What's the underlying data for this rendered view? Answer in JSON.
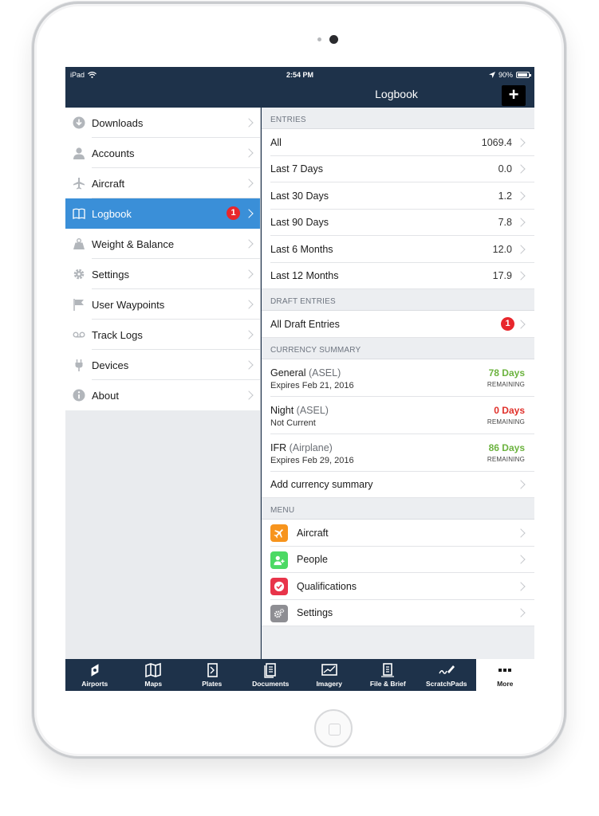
{
  "status_bar": {
    "carrier": "iPad",
    "time": "2:54 PM",
    "battery": "90%"
  },
  "nav": {
    "title": "Logbook",
    "add_label": "+"
  },
  "sidebar": {
    "items": [
      {
        "label": "Downloads",
        "icon": "download-icon"
      },
      {
        "label": "Accounts",
        "icon": "person-icon"
      },
      {
        "label": "Aircraft",
        "icon": "airplane-icon"
      },
      {
        "label": "Logbook",
        "icon": "book-icon",
        "badge": "1",
        "active": true
      },
      {
        "label": "Weight & Balance",
        "icon": "weight-icon"
      },
      {
        "label": "Settings",
        "icon": "gear-icon"
      },
      {
        "label": "User Waypoints",
        "icon": "flag-icon"
      },
      {
        "label": "Track Logs",
        "icon": "tracklog-icon"
      },
      {
        "label": "Devices",
        "icon": "plug-icon"
      },
      {
        "label": "About",
        "icon": "info-icon"
      }
    ]
  },
  "entries": {
    "header": "ENTRIES",
    "rows": [
      {
        "label": "All",
        "value": "1069.4"
      },
      {
        "label": "Last 7 Days",
        "value": "0.0"
      },
      {
        "label": "Last 30 Days",
        "value": "1.2"
      },
      {
        "label": "Last 90 Days",
        "value": "7.8"
      },
      {
        "label": "Last 6 Months",
        "value": "12.0"
      },
      {
        "label": "Last 12 Months",
        "value": "17.9"
      }
    ]
  },
  "draft": {
    "header": "DRAFT ENTRIES",
    "label": "All Draft Entries",
    "badge": "1"
  },
  "currency": {
    "header": "CURRENCY SUMMARY",
    "rows": [
      {
        "name": "General",
        "qual": "(ASEL)",
        "sub": "Expires Feb 21, 2016",
        "days": "78 Days",
        "remaining": "REMAINING",
        "color": "#6cb33f"
      },
      {
        "name": "Night",
        "qual": "(ASEL)",
        "sub": "Not Current",
        "days": "0 Days",
        "remaining": "REMAINING",
        "color": "#e0302a"
      },
      {
        "name": "IFR",
        "qual": "(Airplane)",
        "sub": "Expires Feb 29, 2016",
        "days": "86 Days",
        "remaining": "REMAINING",
        "color": "#6cb33f"
      }
    ],
    "add_label": "Add currency summary"
  },
  "menu": {
    "header": "MENU",
    "items": [
      {
        "label": "Aircraft",
        "icon": "airplane-icon",
        "color": "#f7941d"
      },
      {
        "label": "People",
        "icon": "add-person-icon",
        "color": "#4cd964"
      },
      {
        "label": "Qualifications",
        "icon": "checkmark-badge-icon",
        "color": "#e8344a"
      },
      {
        "label": "Settings",
        "icon": "gear-icon",
        "color": "#8e8e93"
      }
    ]
  },
  "tabbar": {
    "tabs": [
      {
        "label": "Airports"
      },
      {
        "label": "Maps"
      },
      {
        "label": "Plates"
      },
      {
        "label": "Documents"
      },
      {
        "label": "Imagery"
      },
      {
        "label": "File & Brief"
      },
      {
        "label": "ScratchPads"
      },
      {
        "label": "More",
        "active": true
      }
    ]
  },
  "colors": {
    "nav_bg": "#1e324a",
    "accent": "#3a8fd8",
    "badge": "#e8262c"
  }
}
